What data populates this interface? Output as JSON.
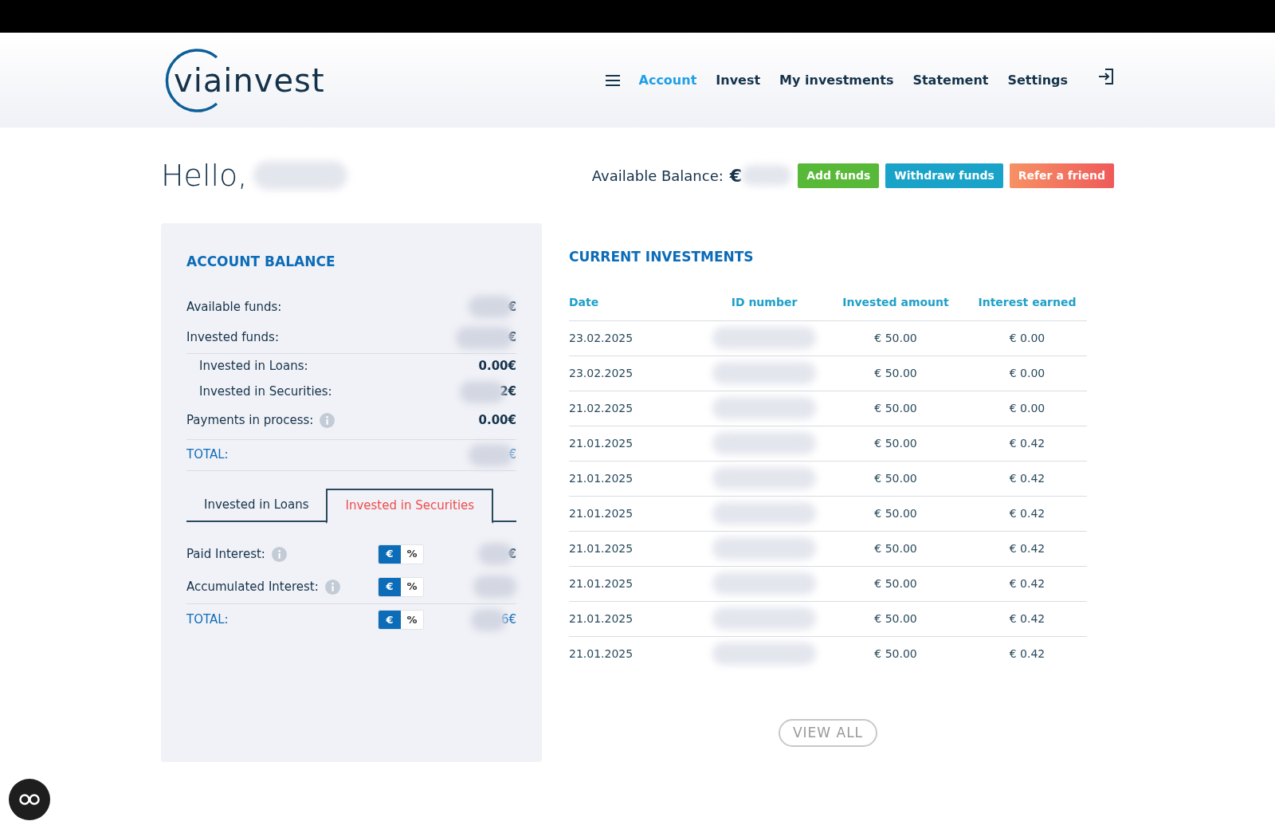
{
  "header": {
    "logo": "viainvest",
    "nav": [
      {
        "label": "Account",
        "selected": true
      },
      {
        "label": "Invest",
        "selected": false
      },
      {
        "label": "My investments",
        "selected": false
      },
      {
        "label": "Statement",
        "selected": false
      },
      {
        "label": "Settings",
        "selected": false
      }
    ]
  },
  "greeting": {
    "text": "Hello,",
    "balance_label": "Available Balance:",
    "currency": "€",
    "buttons": [
      {
        "label": "Add funds",
        "kind": "success"
      },
      {
        "label": "Withdraw funds",
        "kind": "info"
      },
      {
        "label": "Refer a friend",
        "kind": "danger"
      }
    ]
  },
  "account_balance": {
    "title": "ACCOUNT BALANCE",
    "rows": [
      {
        "label": "Available funds:",
        "value": "€",
        "kind": "main",
        "info": false,
        "hidden": true
      },
      {
        "label": "Invested funds:",
        "value": "€",
        "kind": "main",
        "info": false,
        "hidden": true
      },
      {
        "label": "Invested in Loans:",
        "value": "0.00€",
        "kind": "sub",
        "info": false,
        "hidden": false
      },
      {
        "label": "Invested in Securities:",
        "value": "2€",
        "kind": "sub",
        "info": false,
        "hidden": true
      },
      {
        "label": "Payments in process:",
        "value": "0.00€",
        "kind": "main",
        "info": true,
        "hidden": false
      },
      {
        "label": "TOTAL:",
        "value": "€",
        "kind": "total",
        "info": false,
        "hidden": true
      }
    ],
    "tabs": [
      {
        "label": "Invested in Loans",
        "selected": false
      },
      {
        "label": "Invested in Securities",
        "selected": true
      }
    ],
    "interest_rows": [
      {
        "label": "Paid Interest:",
        "info": true,
        "kind": "main",
        "toggle": [
          {
            "label": "€",
            "selected": true
          },
          {
            "label": "%",
            "selected": false
          }
        ],
        "value": "€"
      },
      {
        "label": "Accumulated Interest:",
        "info": true,
        "kind": "main",
        "toggle": [
          {
            "label": "€",
            "selected": true
          },
          {
            "label": "%",
            "selected": false
          }
        ]
      },
      {
        "label": "TOTAL:",
        "info": false,
        "kind": "total",
        "toggle": [
          {
            "label": "€",
            "selected": true
          },
          {
            "label": "%",
            "selected": false
          }
        ],
        "value": "6€"
      }
    ]
  },
  "current_investments": {
    "title": "CURRENT INVESTMENTS",
    "columns": [
      "Date",
      "ID number",
      "Invested amount",
      "Interest earned"
    ],
    "rows": [
      {
        "date": "23.02.2025",
        "amount": "€ 50.00",
        "interest": "€ 0.00"
      },
      {
        "date": "23.02.2025",
        "amount": "€ 50.00",
        "interest": "€ 0.00"
      },
      {
        "date": "21.02.2025",
        "amount": "€ 50.00",
        "interest": "€ 0.00"
      },
      {
        "date": "21.01.2025",
        "amount": "€ 50.00",
        "interest": "€ 0.42"
      },
      {
        "date": "21.01.2025",
        "amount": "€ 50.00",
        "interest": "€ 0.42"
      },
      {
        "date": "21.01.2025",
        "amount": "€ 50.00",
        "interest": "€ 0.42"
      },
      {
        "date": "21.01.2025",
        "amount": "€ 50.00",
        "interest": "€ 0.42"
      },
      {
        "date": "21.01.2025",
        "amount": "€ 50.00",
        "interest": "€ 0.42"
      },
      {
        "date": "21.01.2025",
        "amount": "€ 50.00",
        "interest": "€ 0.42"
      },
      {
        "date": "21.01.2025",
        "amount": "€ 50.00",
        "interest": "€ 0.42"
      }
    ],
    "view_all": "VIEW ALL"
  }
}
